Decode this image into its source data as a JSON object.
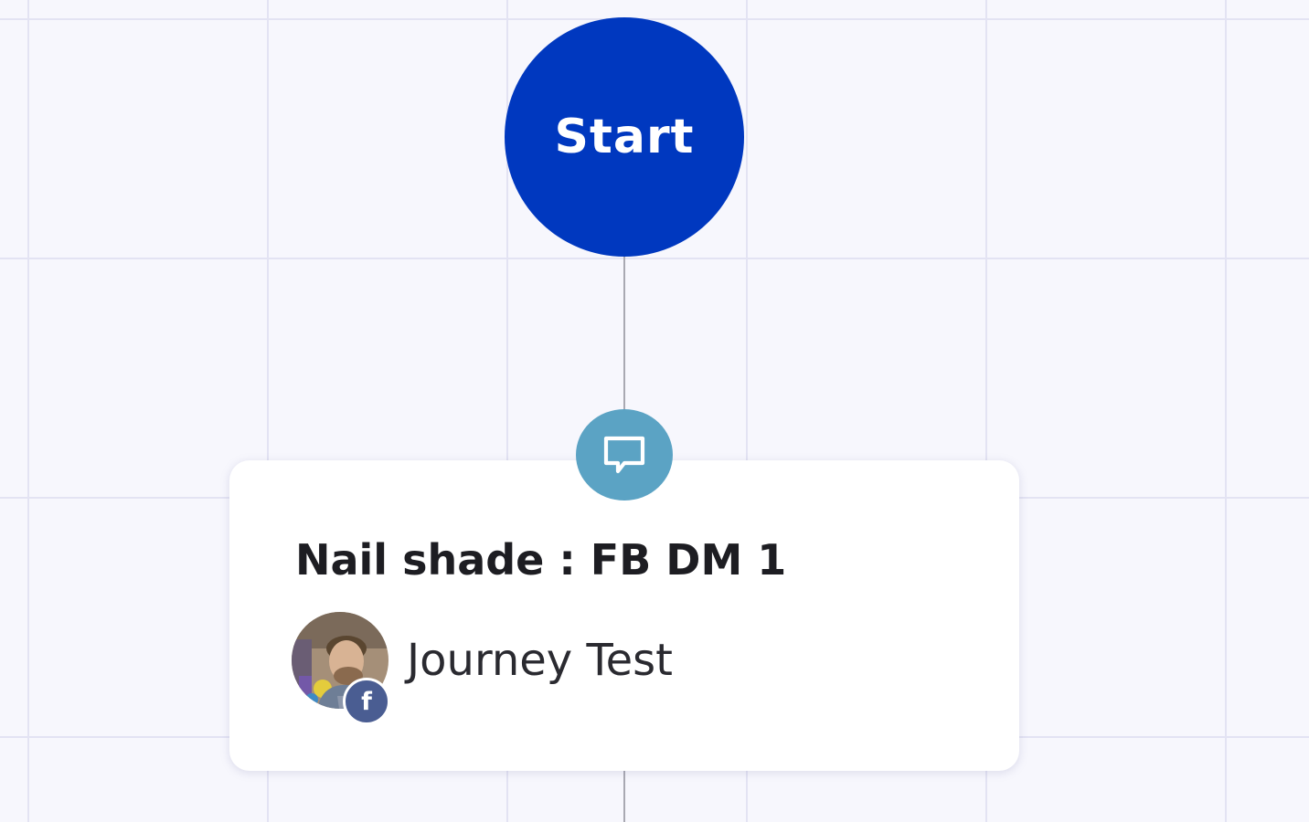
{
  "start_node": {
    "label": "Start"
  },
  "message_node": {
    "icon": "chat-bubble-icon",
    "title": "Nail shade : FB DM 1",
    "account": {
      "name": "Journey Test",
      "channel_icon": "facebook-icon",
      "channel_badge": "f"
    }
  },
  "colors": {
    "start_node": "#0038bf",
    "message_icon_bg": "#5ba3c4",
    "facebook_badge": "#4a5d92",
    "canvas_bg": "#f7f7fd",
    "grid_line": "#e3e3f3",
    "connector": "#a9a9b2"
  }
}
